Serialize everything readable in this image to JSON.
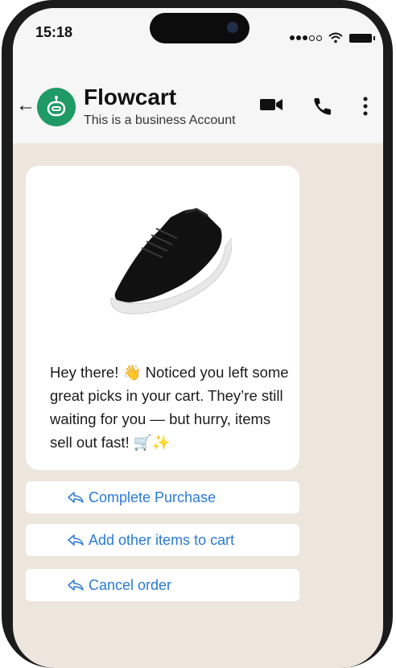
{
  "status_bar": {
    "time": "15:18"
  },
  "chat_header": {
    "name": "Flowcart",
    "subtitle": "This is a business Account"
  },
  "message": {
    "text": "Hey there! 👋 Noticed you left some great picks in your cart. They’re still waiting for you — but hurry, items sell out fast! 🛒✨"
  },
  "quick_replies": [
    {
      "label": "Complete Purchase"
    },
    {
      "label": "Add other items to cart"
    },
    {
      "label": "Cancel order"
    }
  ],
  "colors": {
    "brand_green": "#1f9a66",
    "chat_background": "#ece6dc",
    "link_blue": "#2a7ad5"
  }
}
